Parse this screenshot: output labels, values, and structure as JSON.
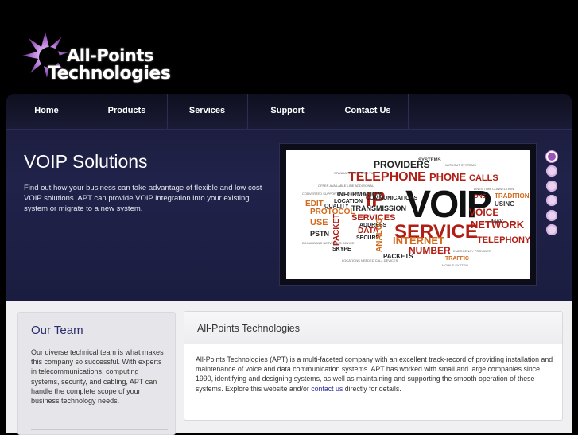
{
  "brand": {
    "line1": "All-Points",
    "line2": "Technologies"
  },
  "nav": [
    {
      "label": "Home"
    },
    {
      "label": "Products"
    },
    {
      "label": "Services"
    },
    {
      "label": "Support"
    },
    {
      "label": "Contact Us"
    }
  ],
  "hero": {
    "title": "VOIP Solutions",
    "text": "Find out how your business can take advantage of flexible and low cost VOIP solutions.  APT can provide VOIP integration into your existing system or migrate to a new system."
  },
  "slide": {
    "words": {
      "main1": "VOIP",
      "main2": "SERVICE",
      "telephone": "TELEPHONE",
      "phone": "PHONE",
      "calls": "CALLS",
      "providers": "PROVIDERS",
      "network": "NETWORK",
      "internet": "INTERNET",
      "telephony": "TELEPHONY",
      "ip": "IP",
      "services": "SERVICES",
      "protocol": "PROTOCOL",
      "data": "DATA",
      "number": "NUMBER",
      "voice": "VOICE",
      "transmission": "TRANSMISSION",
      "packets": "PACKETS",
      "pstn": "PSTN",
      "use": "USE",
      "edit": "EDIT",
      "traditional": "TRADITIONAL",
      "packet": "PACKET",
      "analog": "ANALOG",
      "communications": "COMMUNICATIONS",
      "information": "INFORMATION",
      "location": "LOCATION",
      "address": "ADDRESS",
      "traffic": "TRAFFIC",
      "skype": "SKYPE",
      "systems": "SYSTEMS",
      "quality": "QUALITY",
      "using": "USING",
      "may": "MAY",
      "one": "ONE",
      "secure": "SECURE"
    }
  },
  "slider_dots": [
    {
      "active": true
    },
    {
      "active": false
    },
    {
      "active": false
    },
    {
      "active": false
    },
    {
      "active": false
    },
    {
      "active": false
    }
  ],
  "team": {
    "title": "Our Team",
    "text": "Our diverse technical team is what makes this company so successful. With experts in telecommunications, computing systems, security, and cabling, APT can handle the complete scope of your business technology needs."
  },
  "about": {
    "title": "All-Points Technologies",
    "text_before": "All-Points Technologies (APT) is a multi-faceted company with an excellent track-record of providing installation and maintenance of voice and data communication systems.  APT has worked with small and large companies since 1990, identifying and designing systems, as well as maintaining and supporting the smooth operation of these systems.  Explore this website and/or ",
    "link": "contact us",
    "text_after": " directly for details."
  },
  "colors": {
    "accent": "#9a55b5",
    "nav_bg": "#1a1b36",
    "team_title": "#2a2c6e",
    "word_red": "#b01e14",
    "word_orange": "#d2691e"
  },
  "icons": {
    "logo": "star-burst-icon"
  }
}
